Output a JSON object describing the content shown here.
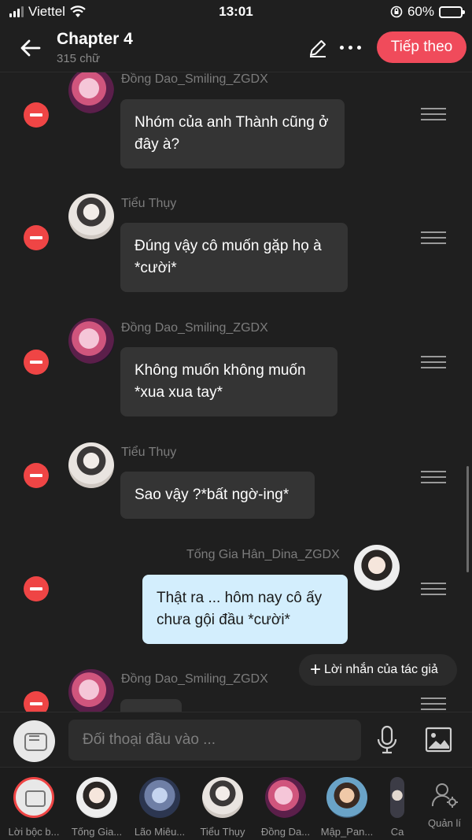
{
  "status": {
    "carrier": "Viettel",
    "time": "13:01",
    "battery": "60%",
    "battery_level": 0.6
  },
  "header": {
    "title": "Chapter 4",
    "subtitle": "315 chữ",
    "next_label": "Tiếp theo"
  },
  "messages": [
    {
      "sender": "Đồng Dao_Smiling_ZGDX",
      "text": "Nhóm của anh Thành cũng ở đây à?",
      "side": "left",
      "avatar": "pink-hair-avatar"
    },
    {
      "sender": "Tiểu Thụy",
      "text": "Đúng vậy cô muốn gặp họ à *cười*",
      "side": "left",
      "avatar": "boy-avatar"
    },
    {
      "sender": "Đồng Dao_Smiling_ZGDX",
      "text": "Không muốn không muốn *xua xua tay*",
      "side": "left",
      "avatar": "pink-hair-avatar"
    },
    {
      "sender": "Tiểu Thụy",
      "text": "Sao vậy ?*bất ngờ-ing*",
      "side": "left",
      "avatar": "boy-avatar"
    },
    {
      "sender": "Tống Gia Hân_Dina_ZGDX",
      "text": "Thật ra ... hôm nay cô ấy chưa gội đầu *cười*",
      "side": "right",
      "avatar": "girl-avatar"
    },
    {
      "sender": "Đồng Dao_Smiling_ZGDX",
      "text": "",
      "side": "left",
      "avatar": "pink-hair-avatar"
    }
  ],
  "author_note": {
    "label": "Lời nhắn của tác giả"
  },
  "input": {
    "placeholder": "Đối thoại đầu vào ..."
  },
  "characters": [
    {
      "label": "Lời bộc b...",
      "selected": true
    },
    {
      "label": "Tống Gia..."
    },
    {
      "label": "Lão Miêu..."
    },
    {
      "label": "Tiểu Thụy"
    },
    {
      "label": "Đồng Da..."
    },
    {
      "label": "Mập_Pan..."
    },
    {
      "label": "Ca"
    }
  ],
  "manage": {
    "label": "Quản lí"
  },
  "colors": {
    "accent": "#f04b5b",
    "delete": "#ef4545",
    "my_bubble": "#d3eefd",
    "bubble": "#343434"
  }
}
